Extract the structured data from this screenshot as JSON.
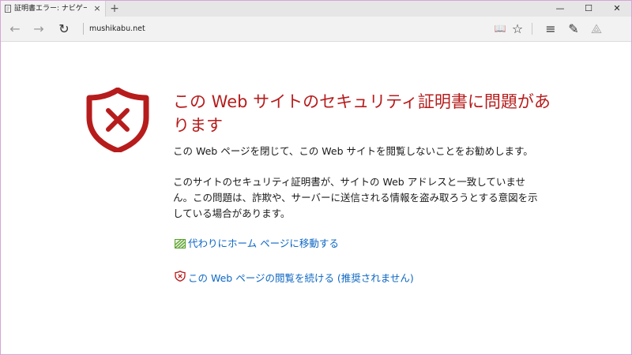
{
  "browser": {
    "tab": {
      "title": "証明書エラー: ナビゲーション",
      "close_glyph": "×",
      "favicon": "page-icon"
    },
    "new_tab_glyph": "+",
    "window_controls": {
      "minimize": "—",
      "maximize": "☐",
      "close": "✕"
    },
    "nav": {
      "back_glyph": "←",
      "forward_glyph": "→",
      "refresh_glyph": "↻",
      "address": "mushikabu.net"
    },
    "toolbar": {
      "reading_view_glyph": "📖",
      "favorite_glyph": "☆",
      "hub_glyph": "≡",
      "note_glyph": "✎",
      "share_glyph": "⟁"
    }
  },
  "error_page": {
    "icon": "shield-x-icon",
    "heading": "この Web サイトのセキュリティ証明書に問題があります",
    "para1": "この Web ページを閉じて、この Web サイトを閲覧しないことをお勧めします。",
    "para2": "このサイトのセキュリティ証明書が、サイトの Web アドレスと一致していません。この問題は、詐欺や、サーバーに送信される情報を盗み取ろうとする意図を示している場合があります。",
    "link_home": "代わりにホーム ページに移動する",
    "link_continue": "この Web ページの閲覧を続ける (推奨されません)"
  },
  "colors": {
    "heading": "#b71c1c",
    "shield": "#b71c1c",
    "link": "#0c67c4",
    "home_icon": "#5aa02c"
  }
}
